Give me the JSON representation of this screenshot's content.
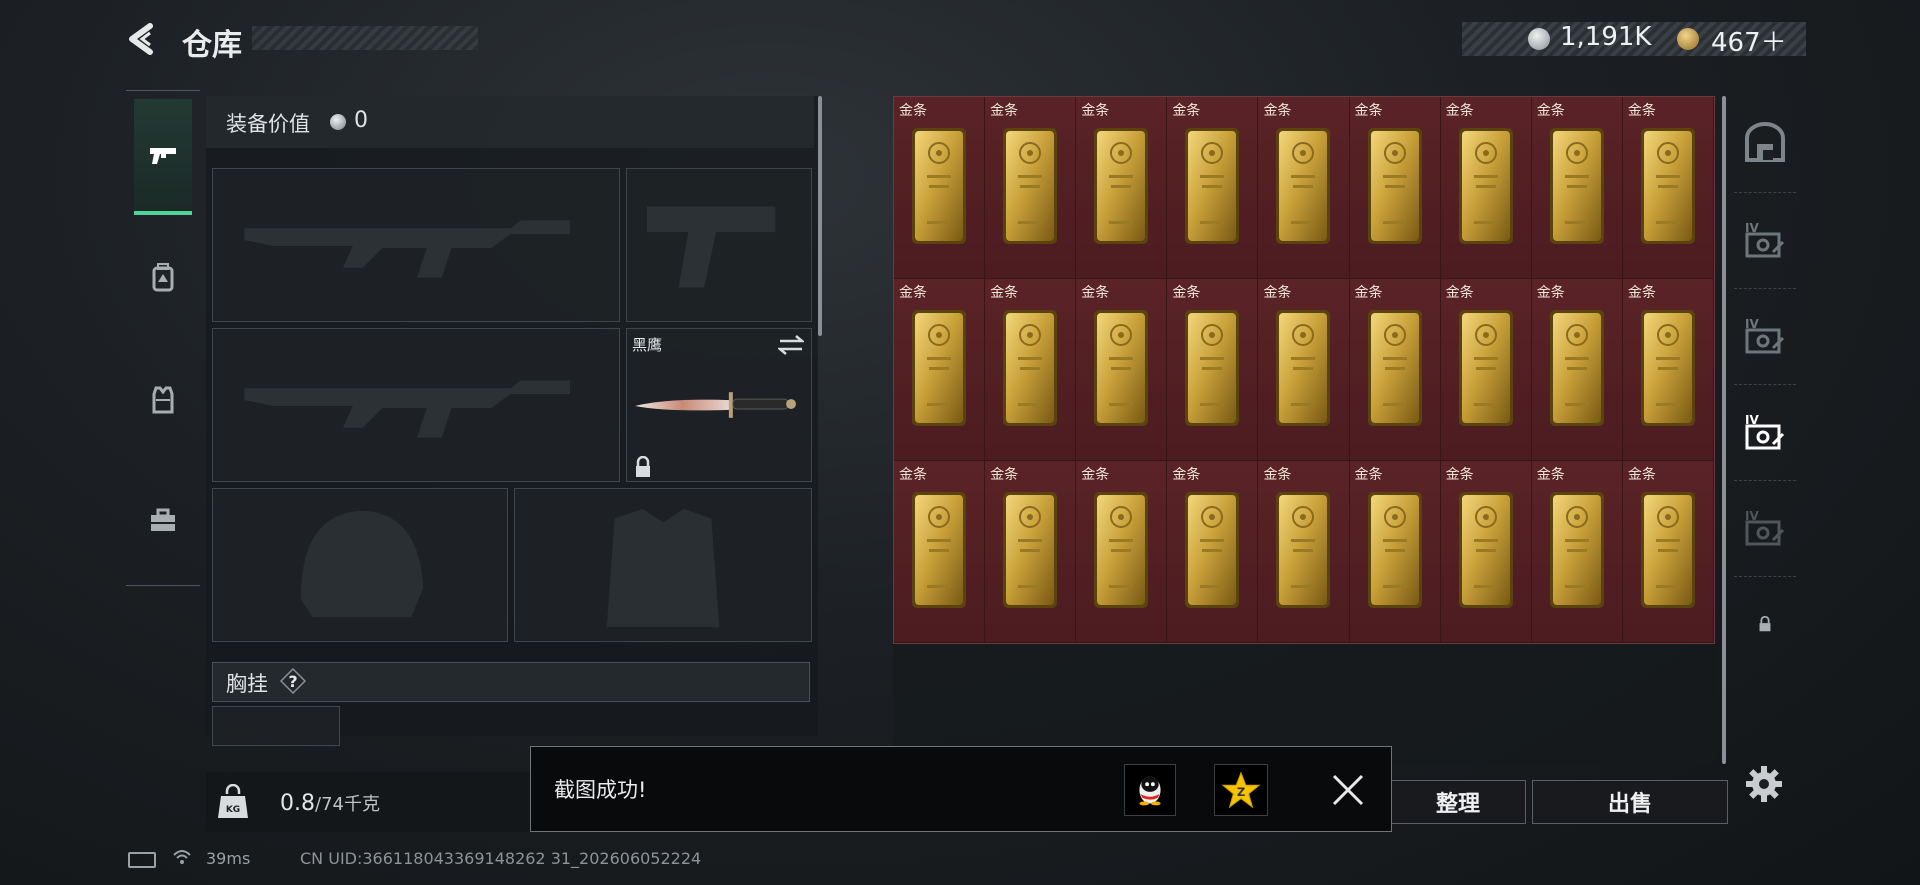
{
  "header": {
    "title": "仓库",
    "currency_silver": "1,191K",
    "currency_gold": "467＋"
  },
  "categories": [
    {
      "icon": "pistol-icon",
      "active": true
    },
    {
      "icon": "backpack-icon",
      "active": false
    },
    {
      "icon": "vest-icon",
      "active": false
    },
    {
      "icon": "toolbox-icon",
      "active": false
    }
  ],
  "equipment": {
    "value_label": "装备价值",
    "value": "0",
    "knife_name": "黑鹰",
    "chest_rig_label": "胸挂",
    "chest_rig_help": "?",
    "weight_current": "0.8",
    "weight_max": "/74千克"
  },
  "storage": {
    "item_label": "金条",
    "rows": 3,
    "cols": 9
  },
  "containers": [
    {
      "icon": "safe-box-icon"
    },
    {
      "icon": "case-iv-icon"
    },
    {
      "icon": "case-iv-icon"
    },
    {
      "icon": "case-iv-icon",
      "active": true
    },
    {
      "icon": "case-iv-icon"
    },
    {
      "icon": "lock-icon"
    }
  ],
  "buttons": {
    "sort": "整理",
    "sell": "出售"
  },
  "toast": {
    "message": "截图成功!"
  },
  "status": {
    "ping": "39ms",
    "uid": "CN UID:366118043369148262 31_202606052224"
  },
  "colors": {
    "accent_green": "#4fd39b",
    "storage_bg": "#4a1e22",
    "gold": "#c9a13a"
  }
}
